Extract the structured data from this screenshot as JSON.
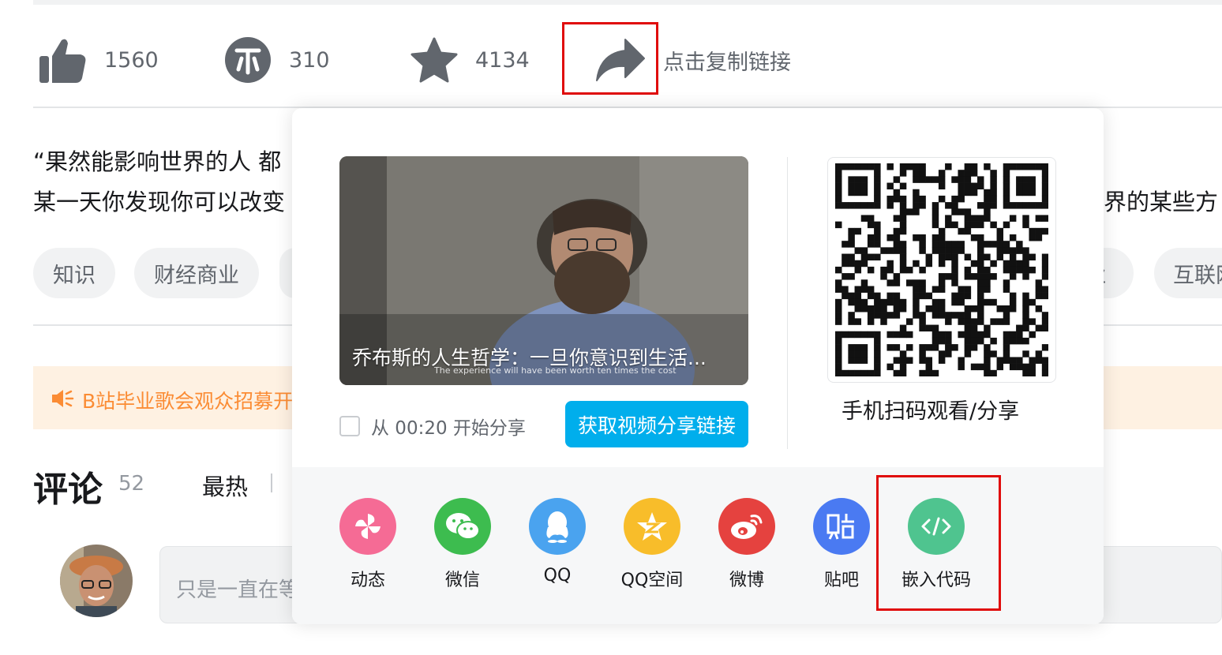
{
  "toolbar": {
    "like_count": "1560",
    "coin_count": "310",
    "favorite_count": "4134",
    "share_hint": "点击复制链接"
  },
  "description": {
    "line1": "“果然能影响世界的人 都",
    "line1_right": "",
    "line2": "某一天你发现你可以改变",
    "line2_right": "界的某些方"
  },
  "tags": [
    "知识",
    "财经商业",
    "业",
    "互联网"
  ],
  "notice": {
    "text": "B站毕业歌会观众招募开"
  },
  "comments": {
    "title": "评论",
    "count": "52",
    "sort_hot": "最热",
    "input_placeholder": "只是一直在等"
  },
  "share_popup": {
    "video_title": "乔布斯的人生哲学：一旦你意识到生活...",
    "video_subtitle_en": "The experience will have been worth ten times the cost",
    "start_share_label": "从 00:20 开始分享",
    "get_link_button": "获取视频分享链接",
    "qr_label": "手机扫码观看/分享",
    "targets": [
      {
        "label": "动态",
        "icon": "pinwheel-icon",
        "color": "#f56b95"
      },
      {
        "label": "微信",
        "icon": "wechat-icon",
        "color": "#3dbc4f"
      },
      {
        "label": "QQ",
        "icon": "qq-icon",
        "color": "#4aa3ef"
      },
      {
        "label": "QQ空间",
        "icon": "qzone-icon",
        "color": "#f8bd2a"
      },
      {
        "label": "微博",
        "icon": "weibo-icon",
        "color": "#e5423f"
      },
      {
        "label": "贴吧",
        "icon": "tieba-icon",
        "color": "#4a7af2"
      },
      {
        "label": "嵌入代码",
        "icon": "embed-code-icon",
        "color": "#4fc48f"
      }
    ]
  },
  "colors": {
    "accent_blue": "#00aeec",
    "highlight_red": "#e00b0b",
    "icon_gray": "#61666d"
  }
}
